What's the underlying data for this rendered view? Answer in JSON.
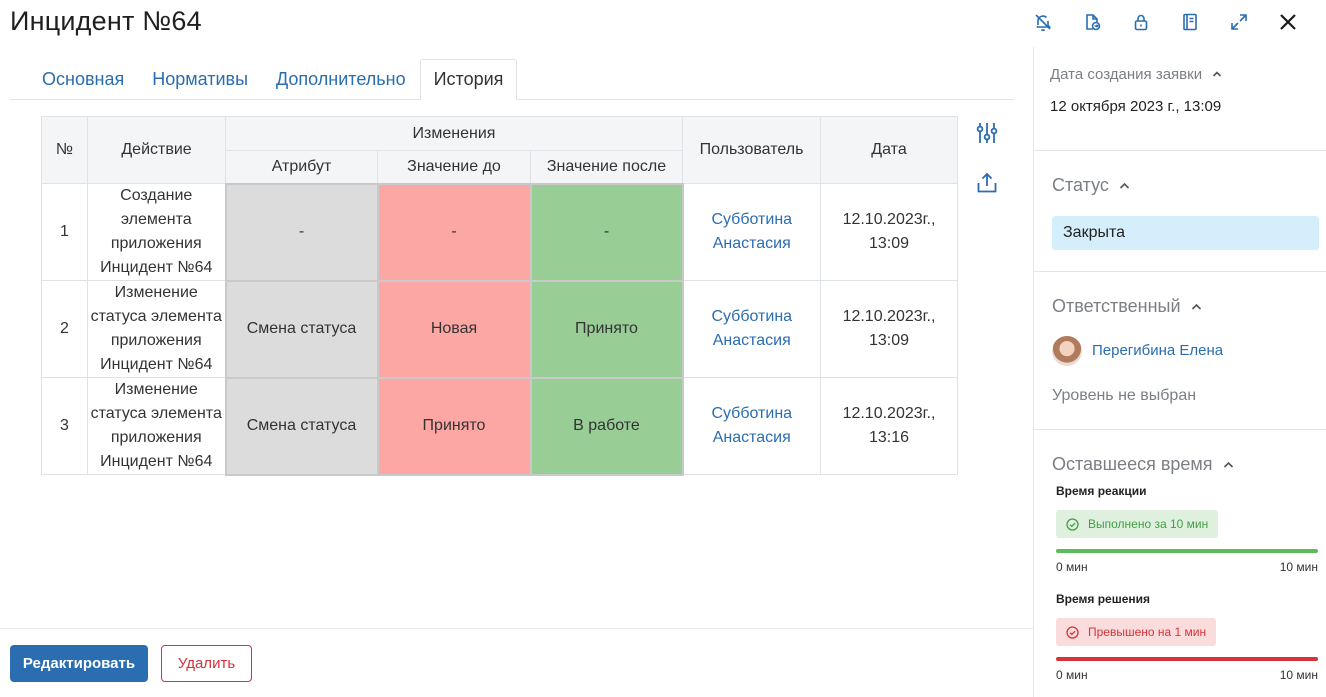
{
  "title": "Инцидент №64",
  "toolbar": {
    "icons": [
      "bell-off-icon",
      "document-export-icon",
      "lock-icon",
      "book-icon",
      "expand-icon",
      "close-icon"
    ]
  },
  "tabs": [
    {
      "label": "Основная",
      "active": false
    },
    {
      "label": "Нормативы",
      "active": false
    },
    {
      "label": "Дополнительно",
      "active": false
    },
    {
      "label": "История",
      "active": true
    }
  ],
  "table": {
    "headers": {
      "num": "№",
      "action": "Действие",
      "changes": "Изменения",
      "attribute": "Атрибут",
      "before": "Значение до",
      "after": "Значение после",
      "user": "Пользователь",
      "date": "Дата"
    },
    "rows": [
      {
        "num": "1",
        "action": "Создание элемента приложения Инцидент №64",
        "attribute": "-",
        "before": "-",
        "after": "-",
        "user": "Субботина Анастасия",
        "date": "12.10.2023г., 13:09"
      },
      {
        "num": "2",
        "action": "Изменение статуса элемента приложения Инцидент №64",
        "attribute": "Смена статуса",
        "before": "Новая",
        "after": "Принято",
        "user": "Субботина Анастасия",
        "date": "12.10.2023г., 13:09"
      },
      {
        "num": "3",
        "action": "Изменение статуса элемента приложения Инцидент №64",
        "attribute": "Смена статуса",
        "before": "Принято",
        "after": "В работе",
        "user": "Субботина Анастасия",
        "date": "12.10.2023г., 13:16"
      }
    ]
  },
  "buttons": {
    "edit": "Редактировать",
    "delete": "Удалить"
  },
  "panel": {
    "created_label": "Дата создания заявки",
    "created_value": "12 октября 2023 г., 13:09",
    "status_label": "Статус",
    "status_value": "Закрыта",
    "responsible_label": "Ответственный",
    "responsible_name": "Перегибина Елена",
    "level": "Уровень не выбран",
    "remaining_label": "Оставшееся время",
    "reaction": {
      "title": "Время реакции",
      "badge": "Выполнено за 10 мин",
      "min": "0 мин",
      "max": "10 мин",
      "progress": 1.0
    },
    "resolution": {
      "title": "Время решения",
      "badge": "Превышено на 1 мин",
      "min": "0 мин",
      "max": "10 мин",
      "progress": 1.0
    }
  },
  "colors": {
    "accent": "#2a6db0",
    "attr_cell": "#dcdcdc",
    "before_cell": "#fda7a5",
    "after_cell": "#99cd96",
    "status_bg": "#d4eefb",
    "danger": "#d6333a",
    "success": "#5dbb5c"
  }
}
